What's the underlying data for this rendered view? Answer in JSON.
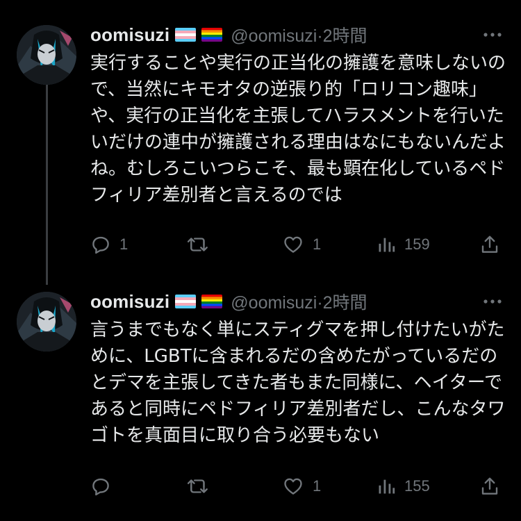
{
  "tweets": [
    {
      "display_name": "oomisuzi",
      "flags": [
        "transgender-flag",
        "rainbow-flag"
      ],
      "handle": "@oomisuzi",
      "separator": "·",
      "time": "2時間",
      "text": "実行することや実行の正当化の擁護を意味しないので、当然にキモオタの逆張り的「ロリコン趣味」や、実行の正当化を主張してハラスメントを行いたいだけの連中が擁護される理由はなにもないんだよね。むしろこいつらこそ、最も顕在化しているペドフィリア差別者と言えるのでは",
      "reply_count": "1",
      "retweet_count": "",
      "like_count": "1",
      "view_count": "159"
    },
    {
      "display_name": "oomisuzi",
      "flags": [
        "transgender-flag",
        "rainbow-flag"
      ],
      "handle": "@oomisuzi",
      "separator": "·",
      "time": "2時間",
      "text": "言うまでもなく単にスティグマを押し付けたいがために、LGBTに含まれるだの含めたがっているだのとデマを主張してきた者もまた同様に、ヘイターであると同時にペドフィリア差別者だし、こんなタワゴトを真面目に取り合う必要もない",
      "reply_count": "",
      "retweet_count": "",
      "like_count": "1",
      "view_count": "155"
    }
  ],
  "colors": {
    "background": "#000000",
    "text_primary": "#e7e9ea",
    "text_secondary": "#71767b",
    "thread_line": "#3a3d41"
  }
}
